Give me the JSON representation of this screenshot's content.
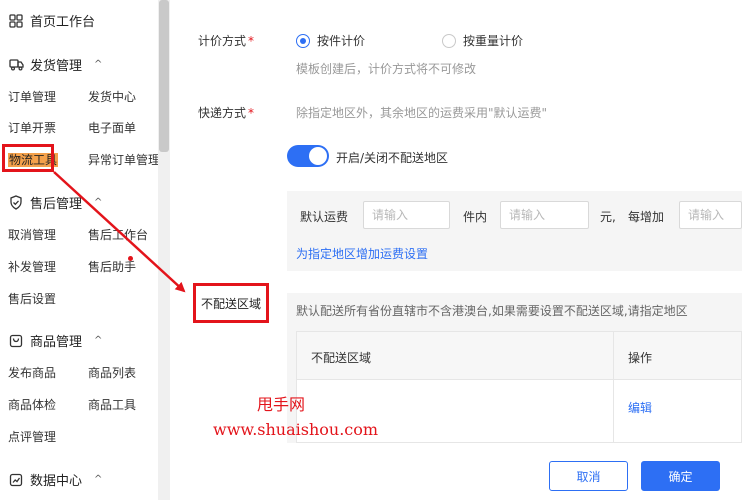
{
  "sidebar": {
    "home": "首页工作台",
    "shipping": {
      "title": "发货管理",
      "items": [
        "订单管理",
        "发货中心",
        "订单开票",
        "电子面单",
        "物流工具",
        "异常订单管理"
      ]
    },
    "aftersale": {
      "title": "售后管理",
      "items": [
        "取消管理",
        "售后工作台",
        "补发管理",
        "售后助手",
        "售后设置"
      ]
    },
    "goods": {
      "title": "商品管理",
      "items": [
        "发布商品",
        "商品列表",
        "商品体检",
        "商品工具",
        "点评管理"
      ]
    },
    "data": {
      "title": "数据中心"
    }
  },
  "form": {
    "pricing_label": "计价方式",
    "pricing_options": [
      "按件计价",
      "按重量计价"
    ],
    "pricing_selected": "按件计价",
    "pricing_hint": "模板创建后，计价方式将不可修改",
    "shipping_label": "快递方式",
    "shipping_hint": "除指定地区外，其余地区的运费采用\"默认运费\"",
    "toggle_label": "开启/关闭不配送地区",
    "default_fee_label": "默认运费",
    "placeholder": "请输入",
    "unit_piece": "件内",
    "unit_yuan": "元,",
    "per_increase": "每增加",
    "add_region_link": "为指定地区增加运费设置",
    "noship_label": "不配送区域",
    "noship_hint": "默认配送所有省份直辖市不含港澳台,如果需要设置不配送区域,请指定地区",
    "table_col_region": "不配送区域",
    "table_col_action": "操作",
    "edit_link": "编辑",
    "cancel": "取消",
    "confirm": "确定"
  },
  "watermark": {
    "line1": "甩手网",
    "line2": "www.shuaishou.com"
  },
  "colors": {
    "accent": "#2d6ff4",
    "annotation": "#e3141b",
    "highlight": "#f4a14b"
  }
}
